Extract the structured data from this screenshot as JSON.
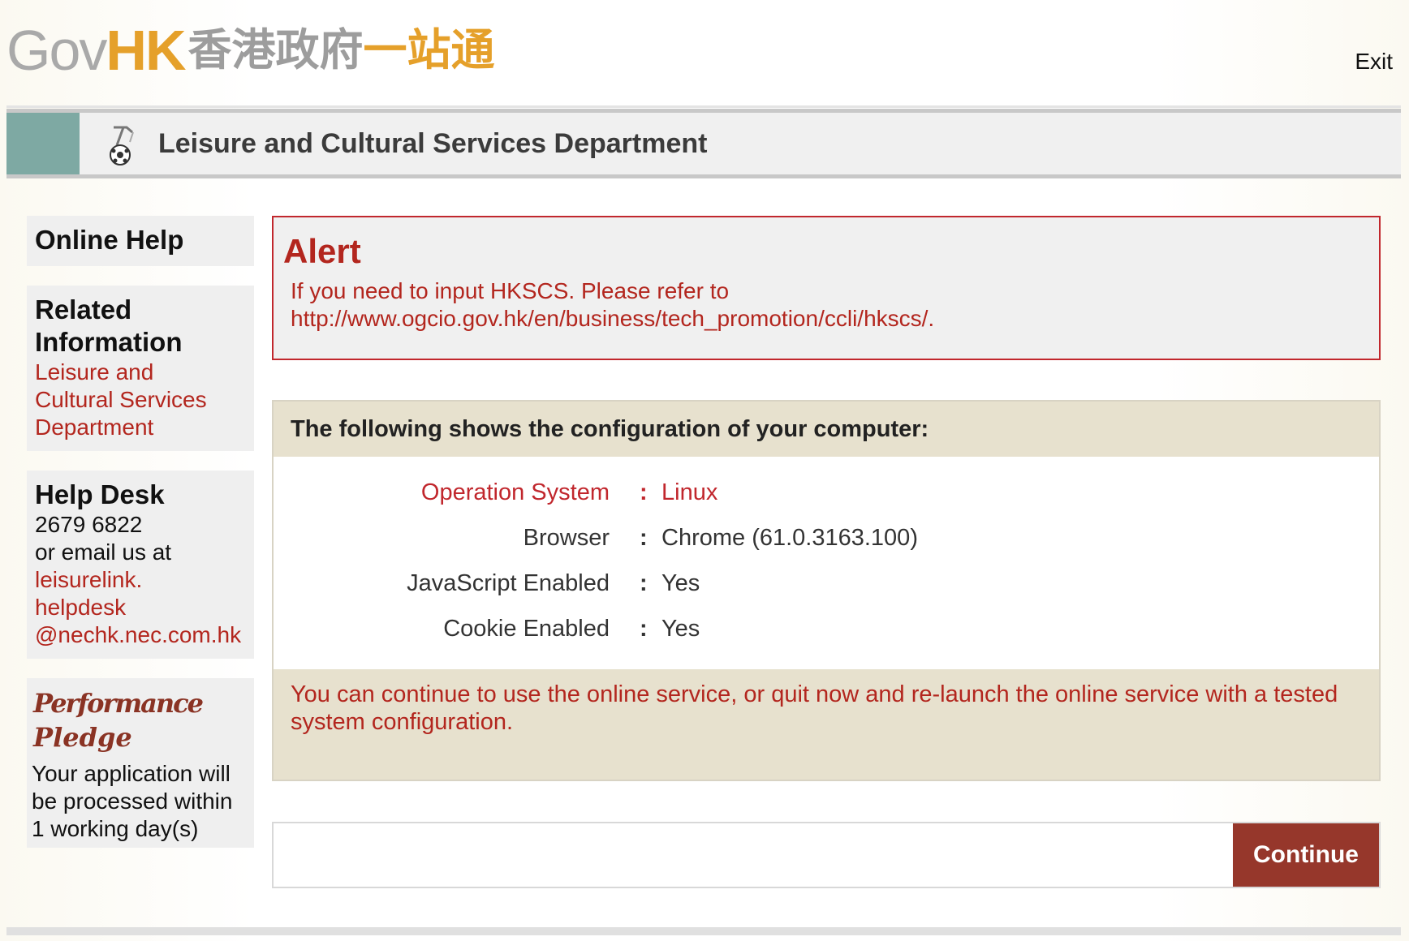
{
  "header": {
    "logo_gov": "Gov",
    "logo_hk": "HK",
    "logo_cn_a": "香港政府",
    "logo_cn_b": "一站通",
    "exit_label": "Exit"
  },
  "department": {
    "title": "Leisure and Cultural Services Department",
    "icon": "lcsd-icon"
  },
  "sidebar": {
    "online_help": "Online Help",
    "related_info": {
      "heading": "Related Information",
      "link_lines": [
        "Leisure and",
        "Cultural Services",
        "Department"
      ]
    },
    "help_desk": {
      "heading": "Help Desk",
      "phone": "2679 6822",
      "email_prefix": "or email us at",
      "email_lines": [
        "leisurelink.",
        "helpdesk",
        "@nechk.nec.com.hk"
      ]
    },
    "pledge": {
      "title": "Performance Pledge",
      "text_lines": [
        "Your application will",
        "be processed within",
        "1 working day(s)"
      ]
    }
  },
  "alert": {
    "title": "Alert",
    "message_lines": [
      "If you need to input HKSCS. Please refer to",
      "http://www.ogcio.gov.hk/en/business/tech_promotion/ccli/hkscs/."
    ]
  },
  "config": {
    "heading": "The following shows the configuration of your computer:",
    "rows": [
      {
        "label": "Operation System",
        "value": "Linux"
      },
      {
        "label": "Browser",
        "value": "Chrome (61.0.3163.100)"
      },
      {
        "label": "JavaScript Enabled",
        "value": "Yes"
      },
      {
        "label": "Cookie Enabled",
        "value": "Yes"
      }
    ],
    "colon": ":",
    "note": "You can continue to use the online service, or quit now and re-launch the online service with a tested system configuration."
  },
  "actions": {
    "continue_label": "Continue"
  },
  "colors": {
    "accent_red": "#b3261e",
    "button_brown": "#96372b",
    "banner_teal": "#7ea9a3",
    "panel_beige": "#e7e1ce",
    "logo_orange": "#e5a02a"
  }
}
